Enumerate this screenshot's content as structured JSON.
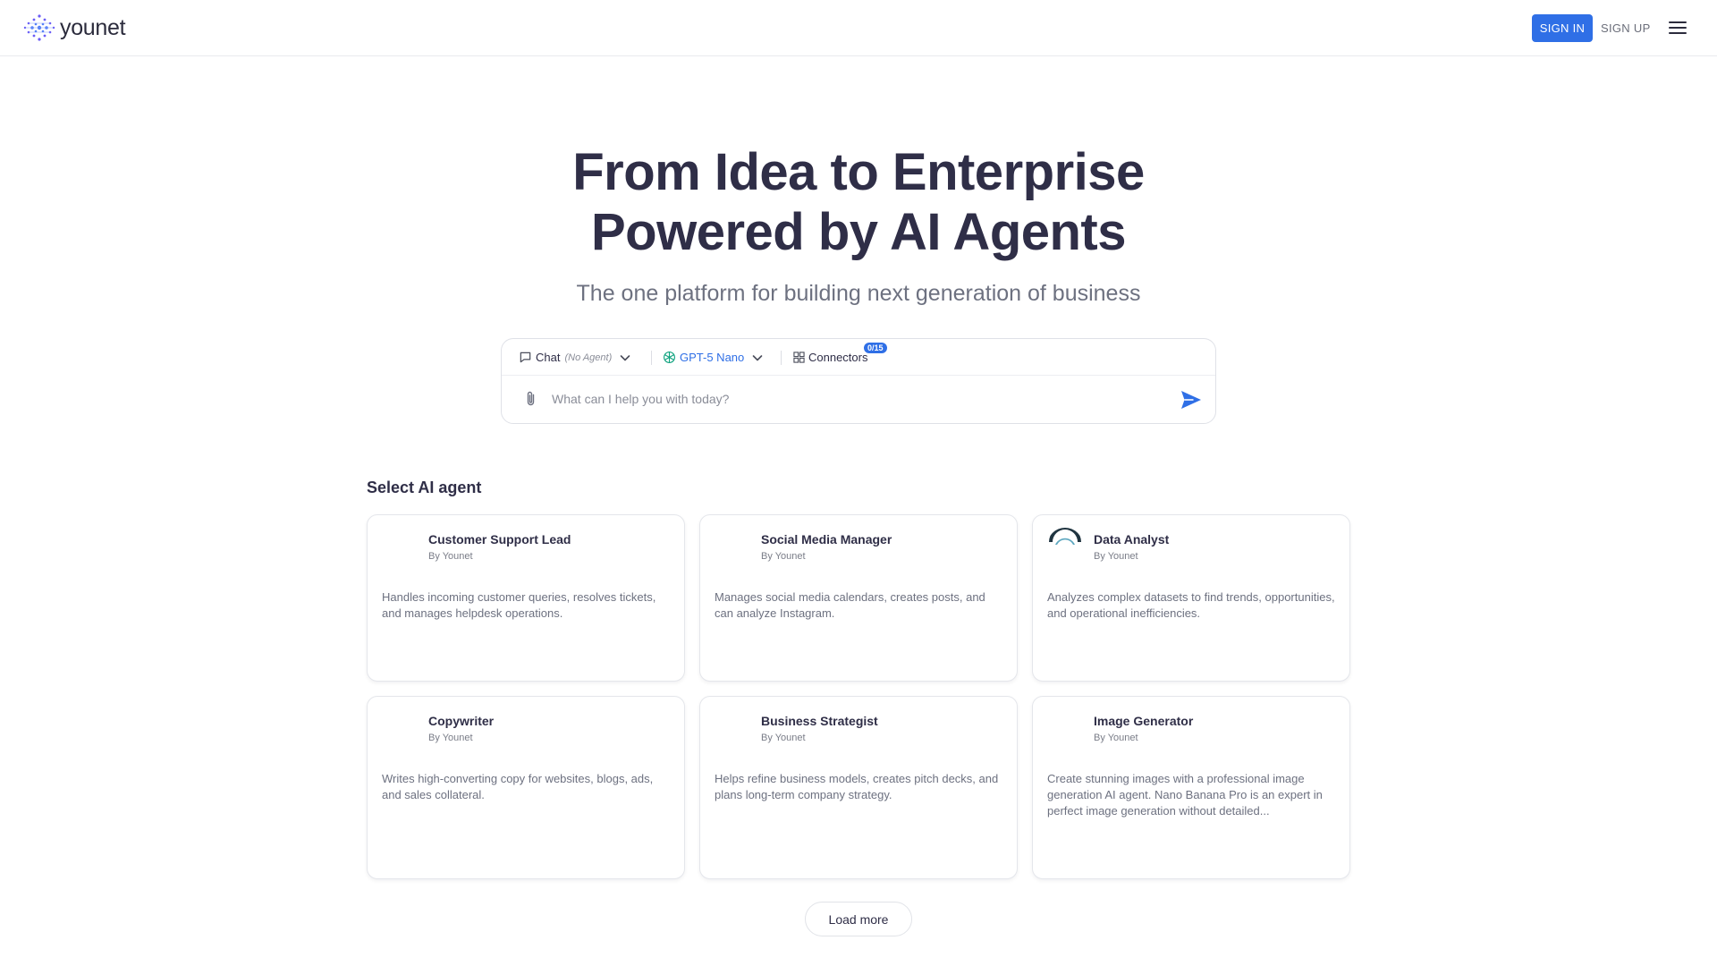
{
  "header": {
    "brand": "younet",
    "sign_in": "SIGN IN",
    "sign_up": "SIGN UP",
    "accent_color": "#2f6fe6"
  },
  "hero": {
    "title_line1": "From Idea to Enterprise",
    "title_line2": "Powered by AI Agents",
    "subtitle": "The one platform for building next generation of business"
  },
  "chat": {
    "mode_label": "Chat",
    "mode_note": "(No Agent)",
    "model_label": "GPT-5 Nano",
    "connectors_label": "Connectors",
    "connectors_badge": "0/15",
    "input_placeholder": "What can I help you with today?",
    "input_value": ""
  },
  "agents": {
    "section_title": "Select AI agent",
    "items": [
      {
        "name": "Customer Support Lead",
        "by": "By Younet",
        "description": "Handles incoming customer queries, resolves tickets, and manages helpdesk operations."
      },
      {
        "name": "Social Media Manager",
        "by": "By Younet",
        "description": "Manages social media calendars, creates posts, and can analyze Instagram."
      },
      {
        "name": "Data Analyst",
        "by": "By Younet",
        "description": "Analyzes complex datasets to find trends, opportunities, and operational inefficiencies."
      },
      {
        "name": "Copywriter",
        "by": "By Younet",
        "description": "Writes high-converting copy for websites, blogs, ads, and sales collateral."
      },
      {
        "name": "Business Strategist",
        "by": "By Younet",
        "description": "Helps refine business models, creates pitch decks, and plans long-term company strategy."
      },
      {
        "name": "Image Generator",
        "by": "By Younet",
        "description": "Create stunning images with a professional image generation AI agent. Nano Banana Pro is an expert in perfect image generation without detailed..."
      }
    ],
    "load_more": "Load more"
  }
}
